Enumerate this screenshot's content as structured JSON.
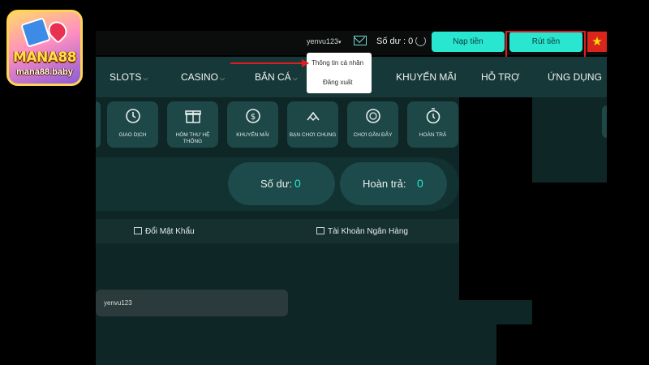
{
  "logo": {
    "name": "MANA88",
    "domain": "mana88.baby"
  },
  "header": {
    "username": "yenvu123",
    "balance_label": "Số dư : 0",
    "deposit_label": "Nạp tiền",
    "withdraw_label": "Rút tiền",
    "flag": "★"
  },
  "user_menu": {
    "items": [
      {
        "label": "Thông tin cá nhân"
      },
      {
        "label": "Đăng xuất"
      }
    ]
  },
  "nav": {
    "items": [
      {
        "label": "SLOTS"
      },
      {
        "label": "CASINO"
      },
      {
        "label": "BẮN CÁ"
      },
      {
        "label": "KHUYẾN MÃI"
      },
      {
        "label": "HỖ TRỢ"
      },
      {
        "label": "ỨNG DỤNG"
      }
    ]
  },
  "shortcuts": [
    {
      "label": "GIAO DỊCH",
      "icon": "history-icon"
    },
    {
      "label": "HÒM THƯ HỆ THỐNG",
      "icon": "gift-icon"
    },
    {
      "label": "KHUYẾN MÃI",
      "icon": "promo-icon"
    },
    {
      "label": "BẠN CHƠI CHUNG",
      "icon": "handshake-icon"
    },
    {
      "label": "CHƠI GẦN ĐÂY",
      "icon": "chip-icon"
    },
    {
      "label": "HOÀN TRẢ",
      "icon": "stopwatch-icon"
    }
  ],
  "summary": {
    "balance_label": "Số dư:",
    "balance_value": "0",
    "rebate_label": "Hoàn trả:",
    "rebate_value": "0"
  },
  "tabs": [
    {
      "label": "Đổi Mật Khẩu"
    },
    {
      "label": "Tài Khoản Ngân Hàng"
    }
  ],
  "form": {
    "username_value": "yenvu123"
  },
  "colors": {
    "accent": "#28e6cf",
    "nav_bg": "#173838",
    "highlight": "#e11b22"
  }
}
